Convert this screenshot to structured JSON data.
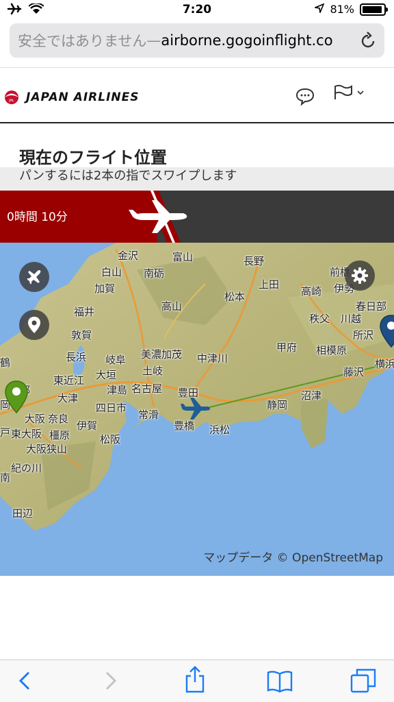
{
  "status": {
    "time": "7:20",
    "battery": "81%"
  },
  "browser": {
    "insecure_label": "安全ではありません",
    "separator": " — ",
    "domain": "airborne.gogoinflight.co"
  },
  "brand": {
    "name": "JAPAN AIRLINES",
    "logo_text": "JAL"
  },
  "page": {
    "title": "現在のフライト位置",
    "swipe_hint": "パンするには2本の指でスワイプします"
  },
  "flight": {
    "remaining_time": "0時間 10分",
    "progress_percent": 40
  },
  "map": {
    "attribution": "マップデータ © OpenStreetMap",
    "cities": [
      {
        "name": "金沢"
      },
      {
        "name": "富山"
      },
      {
        "name": "長野"
      },
      {
        "name": "白山"
      },
      {
        "name": "南砺"
      },
      {
        "name": "加賀"
      },
      {
        "name": "上田"
      },
      {
        "name": "高崎"
      },
      {
        "name": "伊勢"
      },
      {
        "name": "前橋"
      },
      {
        "name": "春日部"
      },
      {
        "name": "松本"
      },
      {
        "name": "高山"
      },
      {
        "name": "福井"
      },
      {
        "name": "秩父"
      },
      {
        "name": "川越"
      },
      {
        "name": "所沢"
      },
      {
        "name": "敦賀"
      },
      {
        "name": "甲府"
      },
      {
        "name": "相模原"
      },
      {
        "name": "長浜"
      },
      {
        "name": "岐阜"
      },
      {
        "name": "美濃加茂"
      },
      {
        "name": "中津川"
      },
      {
        "name": "藤沢"
      },
      {
        "name": "横浜"
      },
      {
        "name": "大垣"
      },
      {
        "name": "土岐"
      },
      {
        "name": "東近江"
      },
      {
        "name": "京都"
      },
      {
        "name": "大津"
      },
      {
        "name": "津島"
      },
      {
        "name": "名古屋"
      },
      {
        "name": "豊田"
      },
      {
        "name": "沼津"
      },
      {
        "name": "静岡"
      },
      {
        "name": "四日市"
      },
      {
        "name": "大阪"
      },
      {
        "name": "奈良"
      },
      {
        "name": "伊賀"
      },
      {
        "name": "常滑"
      },
      {
        "name": "豊橋"
      },
      {
        "name": "浜松"
      },
      {
        "name": "東大阪"
      },
      {
        "name": "橿原"
      },
      {
        "name": "松阪"
      },
      {
        "name": "大阪狭山"
      },
      {
        "name": "紀の川"
      },
      {
        "name": "田辺"
      },
      {
        "name": "鶴"
      },
      {
        "name": "岡"
      },
      {
        "name": "戸"
      },
      {
        "name": "南"
      }
    ]
  },
  "toolbar": {}
}
